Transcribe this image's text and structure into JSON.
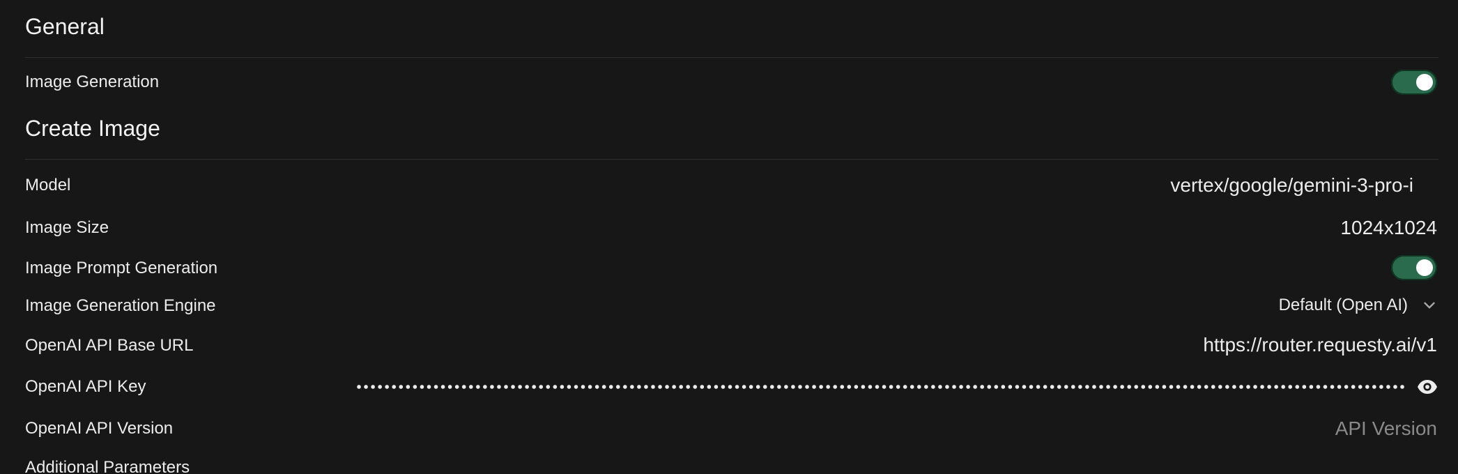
{
  "general": {
    "title": "General",
    "image_generation": {
      "label": "Image Generation",
      "enabled": true
    }
  },
  "create_image": {
    "title": "Create Image",
    "model": {
      "label": "Model",
      "value": "vertex/google/gemini-3-pro-i"
    },
    "image_size": {
      "label": "Image Size",
      "value": "1024x1024"
    },
    "prompt_generation": {
      "label": "Image Prompt Generation",
      "enabled": true
    },
    "engine": {
      "label": "Image Generation Engine",
      "value": "Default (Open AI)"
    },
    "base_url": {
      "label": "OpenAI API Base URL",
      "value": "https://router.requesty.ai/v1"
    },
    "api_key": {
      "label": "OpenAI API Key",
      "value": "••••••••••••••••••••••••••••••••••••••••••••••••••••••••••••••••••••••••••••••••••••••••••••••••••••••••••••••••••••••••••••••••••••••••••••••••••••"
    },
    "api_version": {
      "label": "OpenAI API Version",
      "placeholder": "API Version",
      "value": ""
    },
    "additional_params": {
      "label": "Additional Parameters"
    }
  },
  "icons": {
    "engine_dropdown": "chevron-down-icon",
    "api_key_visibility": "eye-icon"
  },
  "colors": {
    "background": "#171717",
    "toggle_on": "#2a6b4d",
    "text": "#ececec",
    "placeholder": "#8a8a8a"
  }
}
